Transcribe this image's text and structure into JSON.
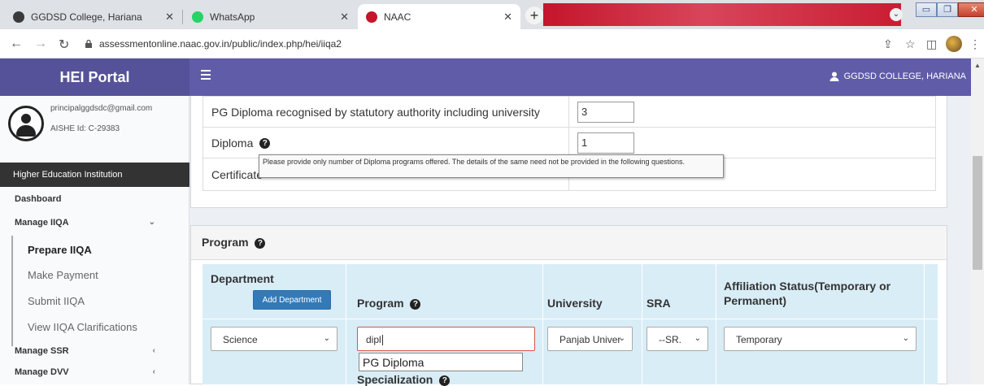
{
  "browser": {
    "tabs": [
      {
        "title": "GGDSD College, Hariana",
        "icon_color": "#3a3a3a"
      },
      {
        "title": "WhatsApp",
        "icon_color": "#25d366"
      },
      {
        "title": "NAAC",
        "icon_color": "#c4152b"
      }
    ],
    "url": "assessmentonline.naac.gov.in/public/index.php/hei/iiqa2"
  },
  "app": {
    "brand": "HEI Portal",
    "user": "GGDSD COLLEGE, HARIANA",
    "colors": {
      "header": "#605ca8",
      "brand": "#555299",
      "primary_button": "#337ab7",
      "table_bg": "#d9edf7",
      "invalid": "#d9534f"
    }
  },
  "sidebar": {
    "email": "principalggdsdc@gmail.com",
    "aishe": "AISHE Id: C-29383",
    "section": "Higher Education Institution",
    "dashboard": "Dashboard",
    "manage_iiqa": "Manage IIQA",
    "sub": {
      "prepare": "Prepare IIQA",
      "payment": "Make Payment",
      "submit": "Submit IIQA",
      "clarifications": "View IIQA Clarifications"
    },
    "manage_ssr": "Manage SSR",
    "manage_dvv": "Manage DVV"
  },
  "questions": {
    "pg_diploma_label": "PG Diploma recognised by statutory authority including university",
    "pg_diploma_value": "3",
    "diploma_label": "Diploma",
    "diploma_value": "1",
    "certificate_label": "Certificate"
  },
  "tooltip": "Please provide only number of Diploma programs offered. The details of the same need not be provided in the following questions.",
  "program": {
    "title": "Program",
    "headers": {
      "department": "Department",
      "program": "Program",
      "university": "University",
      "sra": "SRA",
      "affiliation": "Affiliation Status(Temporary or Permanent)"
    },
    "add_department": "Add Department",
    "department_value": "Science",
    "program_value": "dipl",
    "suggestion": "PG Diploma",
    "university_value": "Panjab Univer",
    "sra_value": "--SR.",
    "affiliation_value": "Temporary",
    "specialization": "Specialization"
  }
}
